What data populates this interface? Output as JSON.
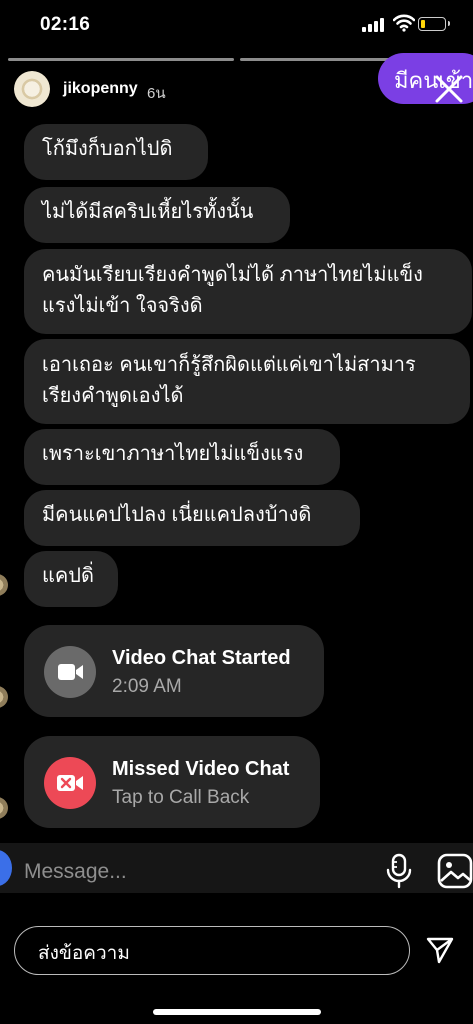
{
  "status_bar": {
    "time": "02:16"
  },
  "header": {
    "username": "jikopenny",
    "time_ago": "6น"
  },
  "toast": {
    "text": "มีคนเข้า"
  },
  "messages": [
    "โก้มึงก็บอกไปดิ",
    "ไม่ได้มีสคริปเหี้ยไรทั้งนั้น",
    "คนมันเรียบเรียงคำพูดไม่ได้ ภาษาไทยไม่แข็งแรงไม่เข้า ใจจริงดิ",
    "เอาเถอะ คนเขาก็รู้สึกผิดแต่แค่เขาไม่สามารเรียงคำพูดเองได้",
    "เพราะเขาภาษาไทยไม่แข็งแรง",
    "มีคนแคปไปลง เนี่ยแคปลงบ้างดิ",
    "แคปดิ่"
  ],
  "cards": {
    "video_started": {
      "title": "Video Chat Started",
      "subtitle": "2:09 AM",
      "color": "#6a6a6a"
    },
    "missed_video": {
      "title": "Missed Video Chat",
      "subtitle": "Tap to Call Back",
      "color": "#ed4956"
    }
  },
  "composer": {
    "placeholder": "Message..."
  },
  "reply": {
    "placeholder": "ส่งข้อความ"
  },
  "icons": [
    "wifi-icon",
    "battery-icon",
    "close-icon",
    "video-camera-icon",
    "missed-video-icon",
    "microphone-icon",
    "gallery-icon",
    "send-icon"
  ]
}
